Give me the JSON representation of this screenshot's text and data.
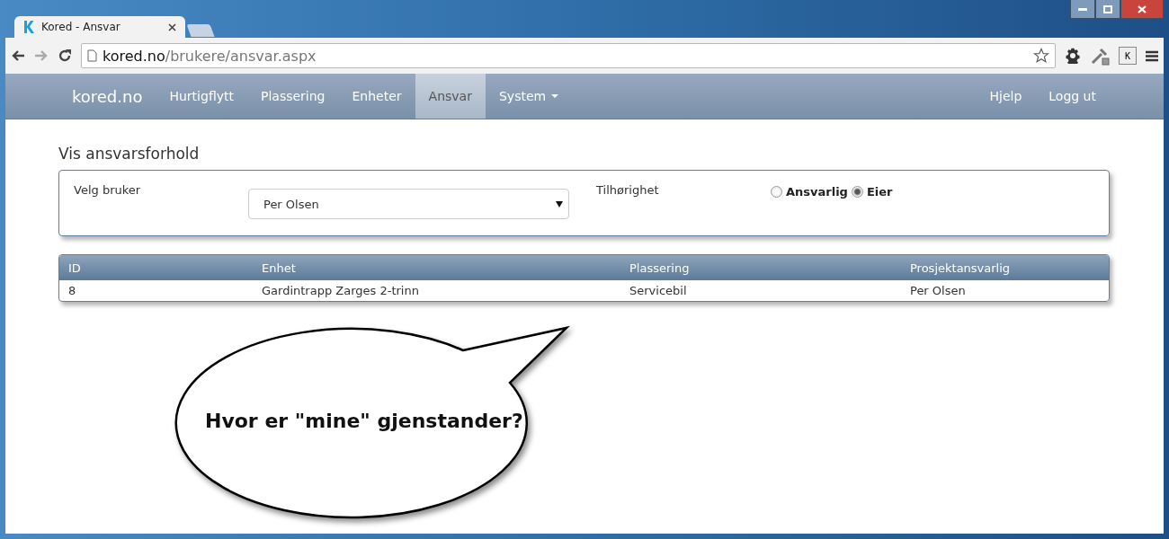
{
  "browser": {
    "tab_title": "Kored - Ansvar",
    "url_host": "kored.no",
    "url_path": "/brukere/ansvar.aspx",
    "extension_key": "K"
  },
  "navbar": {
    "brand": "kored.no",
    "items": [
      {
        "label": "Hurtigflytt",
        "selected": false,
        "dropdown": false
      },
      {
        "label": "Plassering",
        "selected": false,
        "dropdown": false
      },
      {
        "label": "Enheter",
        "selected": false,
        "dropdown": false
      },
      {
        "label": "Ansvar",
        "selected": true,
        "dropdown": false
      },
      {
        "label": "System",
        "selected": false,
        "dropdown": true
      }
    ],
    "right_items": [
      "Hjelp",
      "Logg ut"
    ]
  },
  "page": {
    "title": "Vis ansvarsforhold"
  },
  "filter": {
    "user_label": "Velg bruker",
    "user_value": "Per Olsen",
    "belonging_label": "Tilhørighet",
    "options": [
      {
        "label": "Ansvarlig",
        "selected": false
      },
      {
        "label": "Eier",
        "selected": true
      }
    ]
  },
  "table": {
    "columns": [
      "ID",
      "Enhet",
      "Plassering",
      "Prosjektansvarlig"
    ],
    "rows": [
      [
        "8",
        "Gardintrapp Zarges 2-trinn",
        "Servicebil",
        "Per Olsen"
      ]
    ]
  },
  "callout": {
    "text": "Hvor er \"mine\" gjenstander?"
  }
}
